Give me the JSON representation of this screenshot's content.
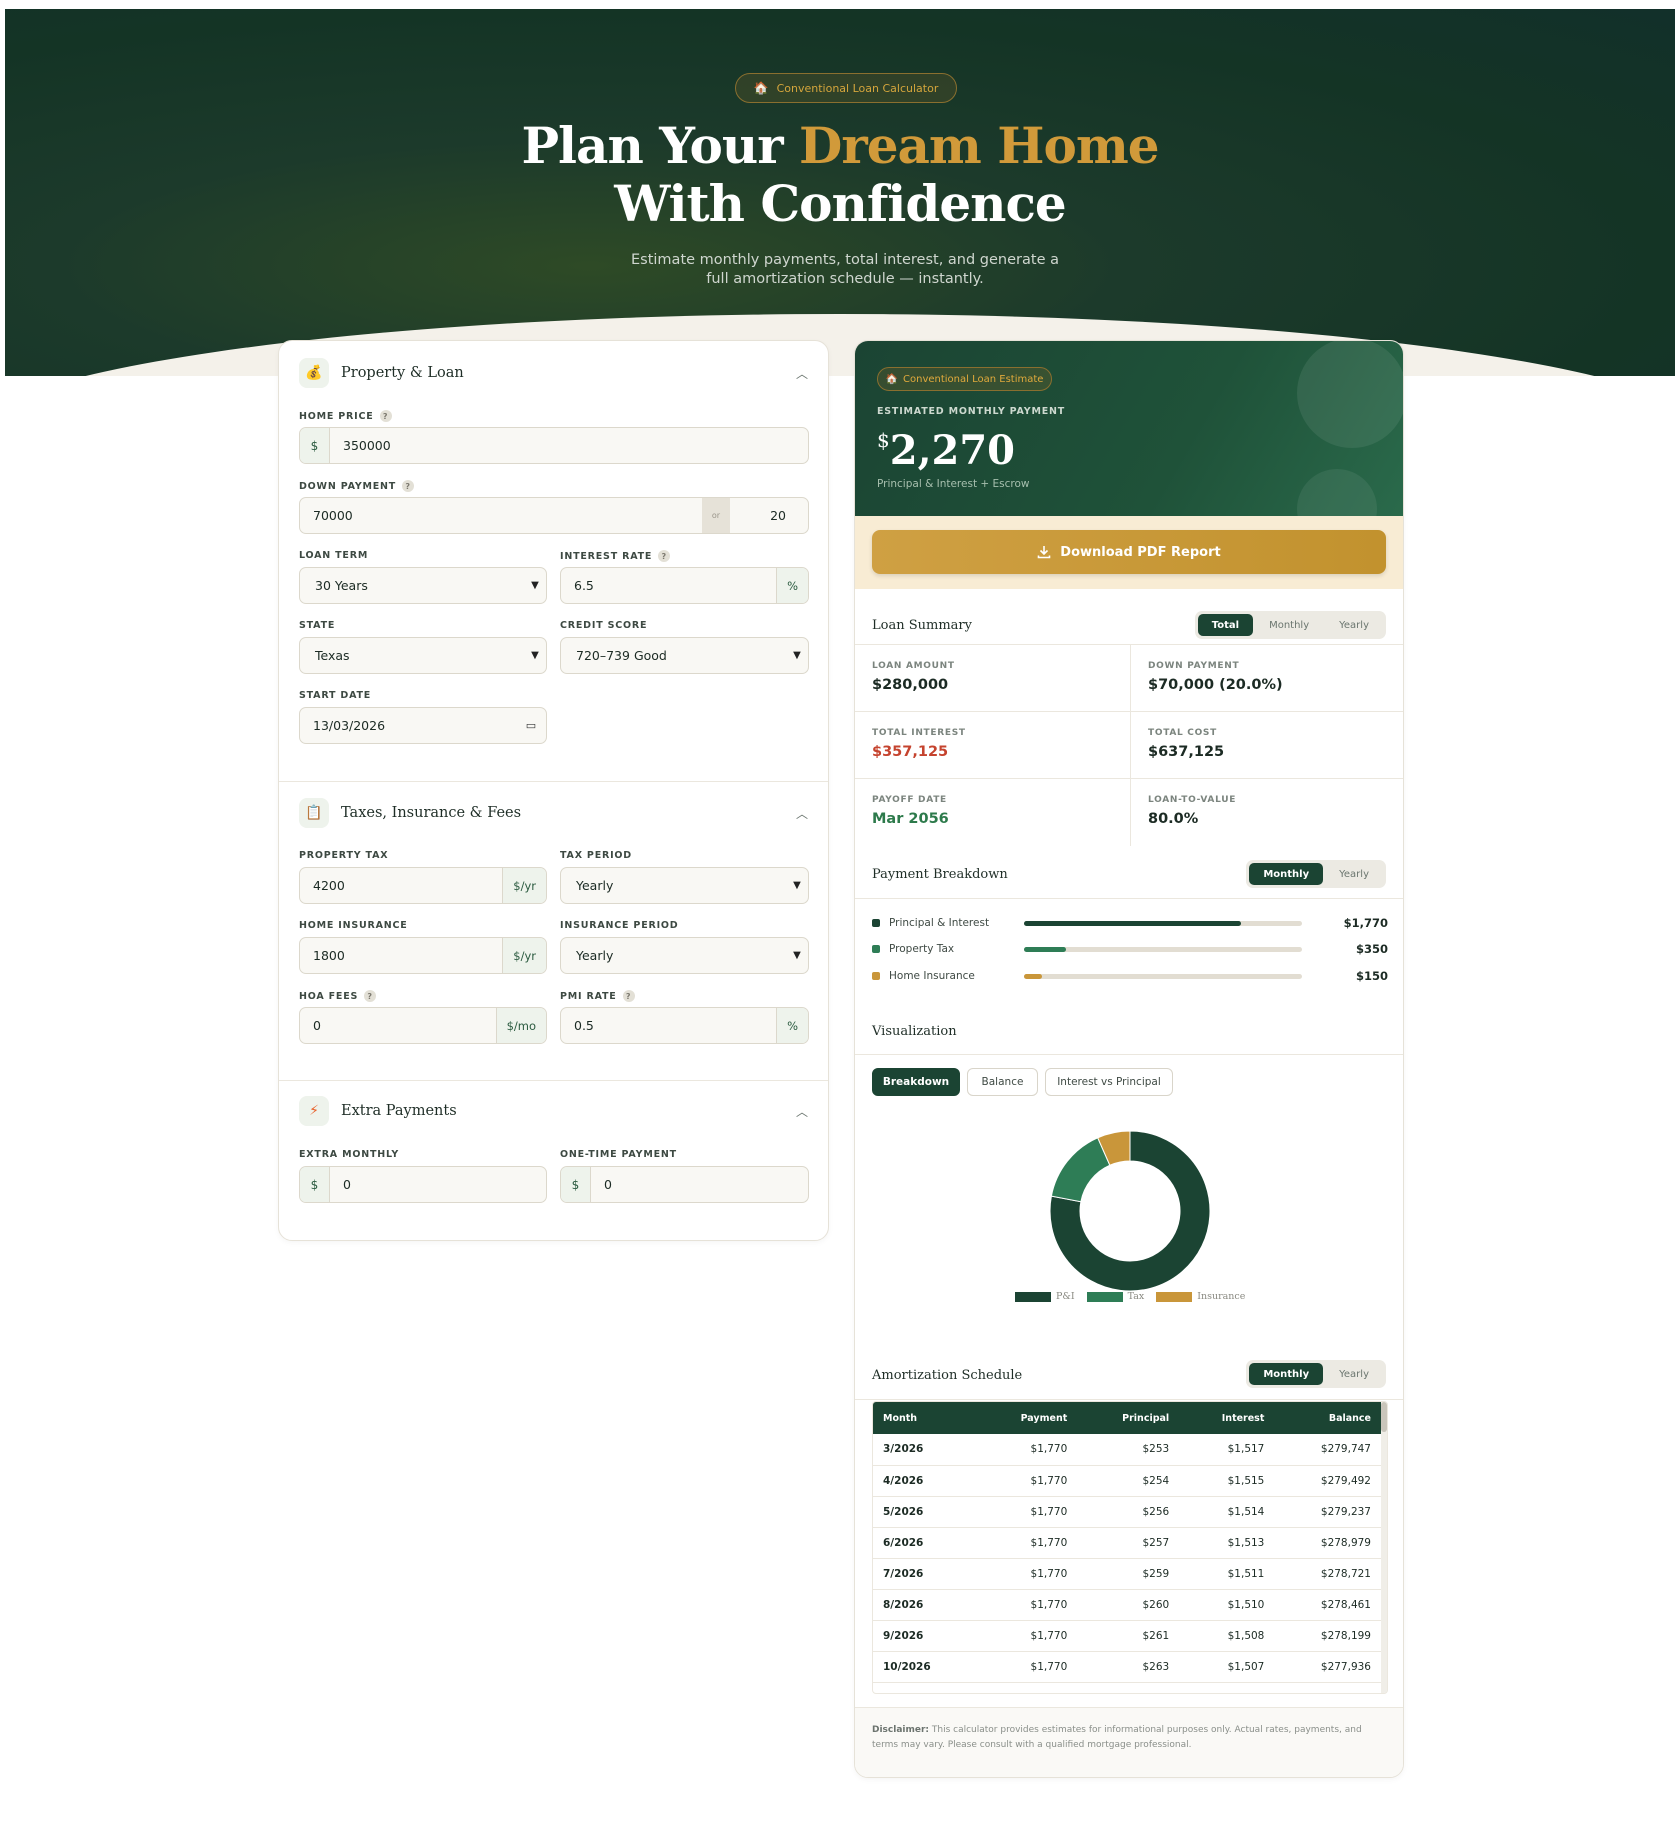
{
  "hero": {
    "badge": "Conventional Loan Calculator",
    "badge_icon": "house-icon",
    "title_part1": "Plan Your ",
    "title_gold": "Dream Home",
    "title_line2": "With Confidence",
    "subtitle": "Estimate monthly payments, total interest, and generate a full amortization schedule — instantly."
  },
  "property": {
    "section_title": "Property & Loan",
    "home_price_label": "HOME PRICE",
    "home_price_prefix": "$",
    "home_price": "350000",
    "down_payment_label": "DOWN PAYMENT",
    "down_payment": "70000",
    "down_or": "or",
    "down_percent": "20",
    "loan_term_label": "LOAN TERM",
    "loan_term": "30 Years",
    "interest_rate_label": "INTEREST RATE",
    "interest_rate": "6.5",
    "interest_suffix": "%",
    "state_label": "STATE",
    "state": "Texas",
    "credit_label": "CREDIT SCORE",
    "credit": "720–739 Good",
    "start_label": "START DATE",
    "start_date": "13/03/2026"
  },
  "taxes": {
    "section_title": "Taxes, Insurance & Fees",
    "property_tax_label": "PROPERTY TAX",
    "property_tax": "4200",
    "property_tax_suffix": "$/yr",
    "tax_period_label": "TAX PERIOD",
    "tax_period": "Yearly",
    "home_ins_label": "HOME INSURANCE",
    "home_ins": "1800",
    "home_ins_suffix": "$/yr",
    "ins_period_label": "INSURANCE PERIOD",
    "ins_period": "Yearly",
    "hoa_label": "HOA FEES",
    "hoa": "0",
    "hoa_suffix": "$/mo",
    "pmi_label": "PMI RATE",
    "pmi": "0.5",
    "pmi_suffix": "%"
  },
  "extra": {
    "section_title": "Extra Payments",
    "monthly_label": "EXTRA MONTHLY",
    "monthly_prefix": "$",
    "monthly": "0",
    "onetime_label": "ONE-TIME PAYMENT",
    "onetime_prefix": "$",
    "onetime": "0"
  },
  "estimate": {
    "badge": "Conventional Loan Estimate",
    "label": "ESTIMATED MONTHLY PAYMENT",
    "currency": "$",
    "amount": "2,270",
    "note": "Principal & Interest + Escrow",
    "pdf_button": "Download PDF Report"
  },
  "summary": {
    "title": "Loan Summary",
    "tabs": [
      "Total",
      "Monthly",
      "Yearly"
    ],
    "loan_amount_label": "LOAN AMOUNT",
    "loan_amount": "$280,000",
    "down_payment_label": "DOWN PAYMENT",
    "down_payment": "$70,000 (20.0%)",
    "total_interest_label": "TOTAL INTEREST",
    "total_interest": "$357,125",
    "total_cost_label": "TOTAL COST",
    "total_cost": "$637,125",
    "payoff_label": "PAYOFF DATE",
    "payoff": "Mar 2056",
    "ltv_label": "LOAN-TO-VALUE",
    "ltv": "80.0%"
  },
  "breakdown": {
    "title": "Payment Breakdown",
    "tabs": [
      "Monthly",
      "Yearly"
    ],
    "items": [
      {
        "name": "Principal & Interest",
        "value": "$1,770",
        "fraction": 0.78,
        "color": "#1b4433"
      },
      {
        "name": "Property Tax",
        "value": "$350",
        "fraction": 0.15,
        "color": "#2e7d56"
      },
      {
        "name": "Home Insurance",
        "value": "$150",
        "fraction": 0.065,
        "color": "#c9963a"
      }
    ]
  },
  "visualization": {
    "title": "Visualization",
    "tabs": [
      "Breakdown",
      "Balance",
      "Interest vs Principal"
    ],
    "legend": [
      "P&I",
      "Tax",
      "Insurance"
    ]
  },
  "chart_data": {
    "type": "pie",
    "categories": [
      "P&I",
      "Tax",
      "Insurance"
    ],
    "values": [
      1770,
      350,
      150
    ],
    "colors": [
      "#1b4433",
      "#2e7d56",
      "#c9963a"
    ]
  },
  "amortization": {
    "title": "Amortization Schedule",
    "tabs": [
      "Monthly",
      "Yearly"
    ],
    "columns": [
      "Month",
      "Payment",
      "Principal",
      "Interest",
      "Balance"
    ],
    "rows": [
      [
        "3/2026",
        "$1,770",
        "$253",
        "$1,517",
        "$279,747"
      ],
      [
        "4/2026",
        "$1,770",
        "$254",
        "$1,515",
        "$279,492"
      ],
      [
        "5/2026",
        "$1,770",
        "$256",
        "$1,514",
        "$279,237"
      ],
      [
        "6/2026",
        "$1,770",
        "$257",
        "$1,513",
        "$278,979"
      ],
      [
        "7/2026",
        "$1,770",
        "$259",
        "$1,511",
        "$278,721"
      ],
      [
        "8/2026",
        "$1,770",
        "$260",
        "$1,510",
        "$278,461"
      ],
      [
        "9/2026",
        "$1,770",
        "$261",
        "$1,508",
        "$278,199"
      ],
      [
        "10/2026",
        "$1,770",
        "$263",
        "$1,507",
        "$277,936"
      ]
    ]
  },
  "disclaimer": {
    "bold": "Disclaimer:",
    "text": " This calculator provides estimates for informational purposes only. Actual rates, payments, and terms may vary. Please consult with a qualified mortgage professional."
  }
}
